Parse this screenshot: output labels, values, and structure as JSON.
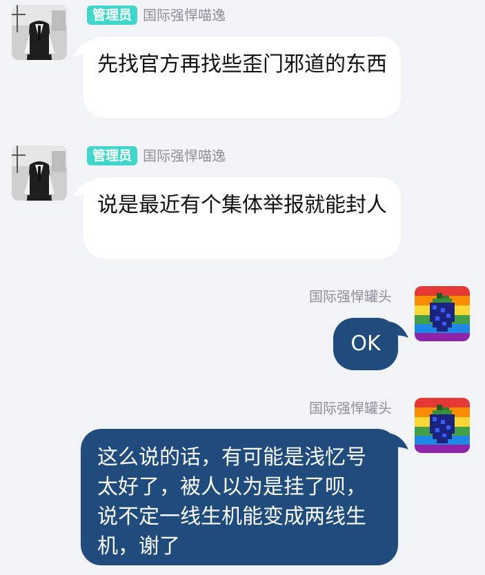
{
  "messages": [
    {
      "direction": "incoming",
      "badge": "管理员",
      "sender": "国际强悍喵逸",
      "text": "先找官方再找些歪门邪道的东西",
      "avatar_icon": "man-in-vest-photo"
    },
    {
      "direction": "incoming",
      "badge": "管理员",
      "sender": "国际强悍喵逸",
      "text": "说是最近有个集体举报就能封人",
      "avatar_icon": "man-in-vest-photo"
    },
    {
      "direction": "outgoing",
      "sender": "国际强悍罐头",
      "text": "OK",
      "avatar_icon": "pixel-berry-rainbow"
    },
    {
      "direction": "outgoing",
      "sender": "国际强悍罐头",
      "text": "这么说的话，有可能是浅忆号太好了，被人以为是挂了呗，说不定一线生机能变成两线生机，谢了",
      "avatar_icon": "pixel-berry-rainbow"
    }
  ],
  "colors": {
    "background": "#f2f3f7",
    "incoming_bubble": "#ffffff",
    "outgoing_bubble": "#1f4b7d",
    "admin_badge": "#41d6cb",
    "sender_name": "#8c8f99"
  }
}
